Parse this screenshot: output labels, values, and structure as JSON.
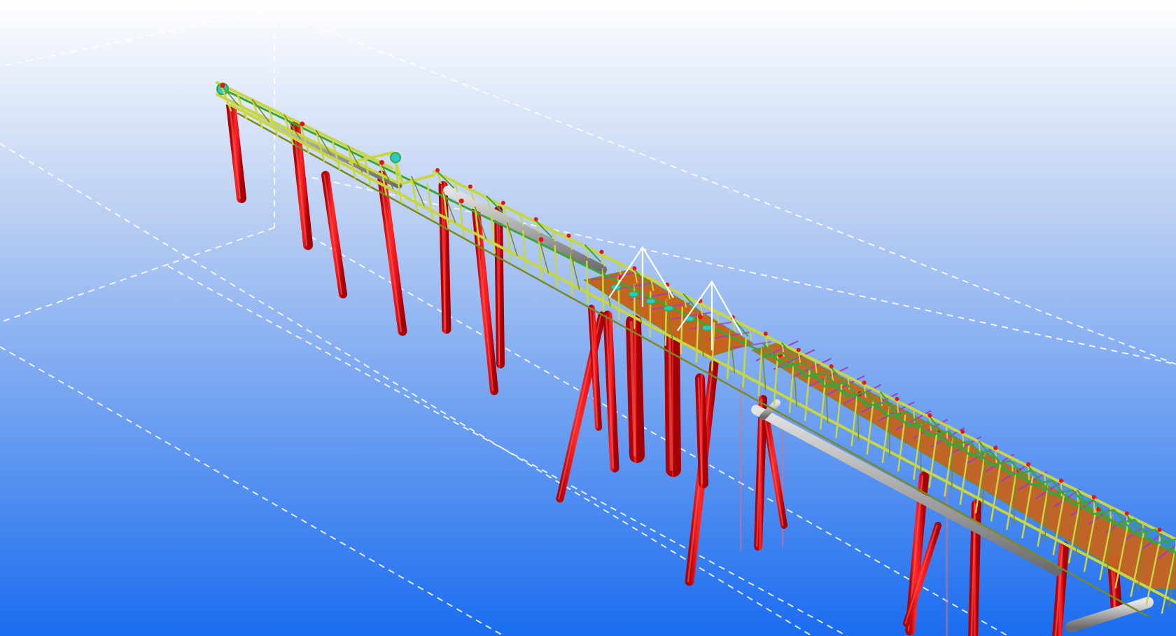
{
  "viewport": {
    "view_type": "3d-model-view",
    "background_top_color": "#ffffff",
    "background_bottom_color": "#1a6cf0",
    "work_area_line_color": "#ffffff"
  },
  "model": {
    "description_icon": "jetty-trestle-3d-model",
    "colors": {
      "piles": "#e8141c",
      "pile_highlight": "#ff6a5a",
      "steel_frames": "#c8d640",
      "steel_frames_dark": "#7a8a1c",
      "bracing": "#3aa63a",
      "pipes": "#a9a9a9",
      "grating_deck": "#c8631e",
      "deck_bracing": "#a03cc8",
      "cyan_fittings": "#2cc8c8",
      "crane_lines": "#ffffff"
    }
  }
}
